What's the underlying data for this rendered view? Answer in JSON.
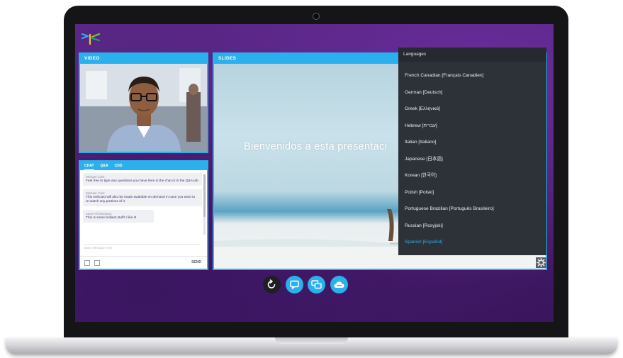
{
  "app": {
    "accent_color": "#2bb0ee",
    "background_color": "#4b1e72"
  },
  "video_panel": {
    "title": "VIDEO"
  },
  "chat_panel": {
    "tabs": [
      {
        "label": "CHAT",
        "active": true
      },
      {
        "label": "Q&A",
        "active": false
      },
      {
        "label": "CDD",
        "active": false
      }
    ],
    "messages": [
      {
        "sender": "Michael Cole:",
        "text": "Feel free to type any questions you have here in the chat or in the Q&A tab"
      },
      {
        "sender": "Michael Cole:",
        "text": "This webcast will also be made available on demand in case you want to re-watch any portions of it"
      },
      {
        "sender": "Karen Richardson:",
        "text": "This is some brilliant stuff! I like it!"
      }
    ],
    "input_placeholder": "Enter Message Here",
    "send_label": "SEND",
    "icons": [
      "attachment-icon",
      "image-icon"
    ]
  },
  "slides_panel": {
    "title": "SLIDES",
    "slide_title": "Bienvenidos a esta presentaci"
  },
  "language_menu": {
    "header": "Languages",
    "items": [
      {
        "label": "French Canadian [Français Canadien]",
        "selected": false
      },
      {
        "label": "German [Deutsch]",
        "selected": false
      },
      {
        "label": "Greek [Ελληνικά]",
        "selected": false
      },
      {
        "label": "Hebrew [עברית]",
        "selected": false
      },
      {
        "label": "Italian [Italiano]",
        "selected": false
      },
      {
        "label": "Japanese [日本語]",
        "selected": false
      },
      {
        "label": "Korean [한국어]",
        "selected": false
      },
      {
        "label": "Polish [Polski]",
        "selected": false
      },
      {
        "label": "Portuguese Brazilian [Português Brasileiro]",
        "selected": false
      },
      {
        "label": "Russian [Rosyjski]",
        "selected": false
      },
      {
        "label": "Spanish [Español]",
        "selected": true
      }
    ],
    "selected_color": "#2bb0ee"
  },
  "controls": [
    {
      "name": "refresh-button",
      "icon": "refresh-icon"
    },
    {
      "name": "chat-button",
      "icon": "chat-bubble-icon"
    },
    {
      "name": "qa-button",
      "icon": "two-bubbles-icon"
    },
    {
      "name": "cdd-button",
      "icon": "cloud-icon"
    }
  ]
}
